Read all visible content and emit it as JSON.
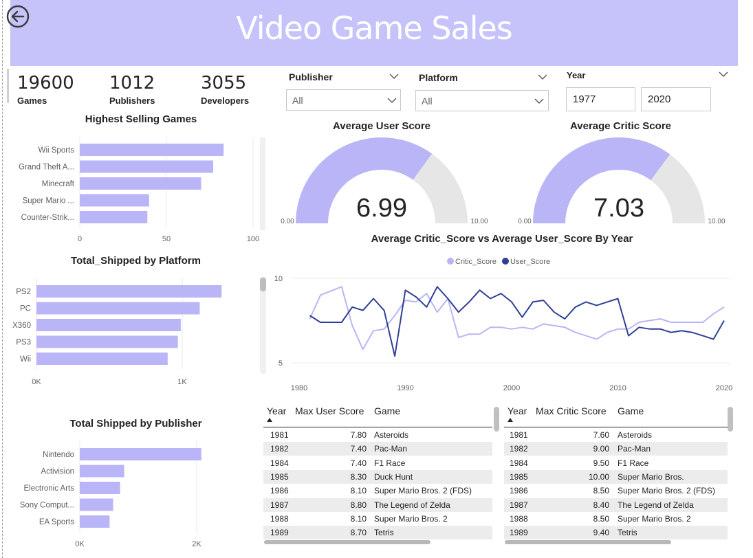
{
  "header": {
    "title": "Video Game Sales"
  },
  "kpis": [
    {
      "value": "19600",
      "label": "Games"
    },
    {
      "value": "1012",
      "label": "Publishers"
    },
    {
      "value": "3055",
      "label": "Developers"
    }
  ],
  "slicers": {
    "publisher": {
      "label": "Publisher",
      "value": "All"
    },
    "platform": {
      "label": "Platform",
      "value": "All"
    },
    "year": {
      "label": "Year",
      "from": "1977",
      "to": "2020"
    }
  },
  "colors": {
    "accent": "#c6c3fb",
    "bar": "#b9b5f7",
    "critic": "#b9b5f7",
    "user": "#2f3f96",
    "gauge_bg": "#e6e6e6"
  },
  "chart_data": [
    {
      "id": "highest_selling",
      "type": "bar",
      "title": "Highest Selling Games",
      "categories": [
        "Wii Sports",
        "Grand Theft A...",
        "Minecraft",
        "Super Mario ...",
        "Counter-Strik..."
      ],
      "values": [
        83,
        77,
        70,
        40,
        39
      ],
      "xlim": [
        0,
        100
      ],
      "xticks": [
        "0",
        "50",
        "100"
      ]
    },
    {
      "id": "shipped_platform",
      "type": "bar",
      "title": "Total_Shipped by Platform",
      "categories": [
        "PS2",
        "PC",
        "X360",
        "PS3",
        "Wii"
      ],
      "values": [
        1270,
        1120,
        990,
        970,
        900
      ],
      "xlim": [
        0,
        1000
      ],
      "xticks": [
        "0K",
        "1K"
      ]
    },
    {
      "id": "shipped_publisher",
      "type": "bar",
      "title": "Total Shipped by Publisher",
      "categories": [
        "Nintendo",
        "Activision",
        "Electronic Arts",
        "Sony Comput...",
        "EA Sports"
      ],
      "values": [
        2080,
        760,
        690,
        570,
        510
      ],
      "xlim": [
        0,
        2000
      ],
      "xticks": [
        "0K",
        "2K"
      ]
    },
    {
      "id": "avg_user_gauge",
      "type": "gauge",
      "title": "Average User Score",
      "value": 6.99,
      "value_label": "6.99",
      "min_label": "0.00",
      "max_label": "10.00",
      "max": 10
    },
    {
      "id": "avg_critic_gauge",
      "type": "gauge",
      "title": "Average Critic Score",
      "value": 7.03,
      "value_label": "7.03",
      "min_label": "0.00",
      "max_label": "10.00",
      "max": 10
    },
    {
      "id": "score_by_year",
      "type": "line",
      "title": "Average Critic_Score vs Average  User_Score By Year",
      "x": [
        1981,
        1982,
        1984,
        1985,
        1986,
        1987,
        1988,
        1989,
        1990,
        1991,
        1992,
        1993,
        1994,
        1995,
        1996,
        1997,
        1998,
        1999,
        2000,
        2001,
        2002,
        2003,
        2004,
        2005,
        2006,
        2007,
        2008,
        2009,
        2010,
        2011,
        2012,
        2013,
        2014,
        2015,
        2016,
        2017,
        2018,
        2019,
        2020
      ],
      "series": [
        {
          "name": "Critic_Score",
          "values": [
            7.6,
            9.0,
            9.5,
            7.2,
            5.8,
            6.9,
            7.0,
            7.8,
            8.7,
            8.6,
            9.1,
            8.0,
            8.8,
            6.5,
            6.7,
            6.7,
            7.1,
            7.1,
            7.0,
            7.1,
            7.0,
            7.3,
            7.2,
            7.1,
            6.8,
            6.6,
            6.4,
            6.8,
            7.0,
            7.0,
            7.4,
            7.5,
            7.6,
            7.4,
            7.4,
            7.4,
            7.4,
            7.9,
            8.3
          ]
        },
        {
          "name": "User_Score",
          "values": [
            7.8,
            7.4,
            7.4,
            8.3,
            8.1,
            8.8,
            8.1,
            5.4,
            9.3,
            8.9,
            8.3,
            9.5,
            8.8,
            8.0,
            8.6,
            9.3,
            8.8,
            9.1,
            8.6,
            7.7,
            8.6,
            8.7,
            8.0,
            7.6,
            8.3,
            8.6,
            8.4,
            8.6,
            8.8,
            6.6,
            7.1,
            7.0,
            7.0,
            6.8,
            6.9,
            6.8,
            6.6,
            6.4,
            7.5
          ]
        }
      ],
      "xticks": [
        "1980",
        "1990",
        "2000",
        "2010",
        "2020"
      ],
      "yticks": [
        "5",
        "10"
      ],
      "xlim": [
        1980,
        2020
      ],
      "ylim": [
        5,
        10
      ],
      "legend": "top-center"
    }
  ],
  "tables": {
    "user": {
      "headers": [
        "Year",
        "Max User Score",
        "Game"
      ],
      "rows": [
        [
          "1981",
          "7.80",
          "Asteroids"
        ],
        [
          "1982",
          "7.40",
          "Pac-Man"
        ],
        [
          "1984",
          "7.40",
          "F1 Race"
        ],
        [
          "1985",
          "8.30",
          "Duck Hunt"
        ],
        [
          "1986",
          "8.10",
          "Super Mario Bros. 2 (FDS)"
        ],
        [
          "1987",
          "8.80",
          "The Legend of Zelda"
        ],
        [
          "1988",
          "8.10",
          "Super Mario Bros. 2"
        ],
        [
          "1989",
          "8.70",
          "Tetris"
        ]
      ]
    },
    "critic": {
      "headers": [
        "Year",
        "Max Critic Score",
        "Game"
      ],
      "rows": [
        [
          "1981",
          "7.60",
          "Asteroids"
        ],
        [
          "1982",
          "9.00",
          "Pac-Man"
        ],
        [
          "1984",
          "9.50",
          "F1 Race"
        ],
        [
          "1985",
          "10.00",
          "Super Mario Bros."
        ],
        [
          "1986",
          "8.50",
          "Super Mario Bros. 2 (FDS)"
        ],
        [
          "1987",
          "8.40",
          "The Legend of Zelda"
        ],
        [
          "1988",
          "8.50",
          "Super Mario Bros. 2"
        ],
        [
          "1989",
          "9.40",
          "Tetris"
        ]
      ]
    }
  }
}
